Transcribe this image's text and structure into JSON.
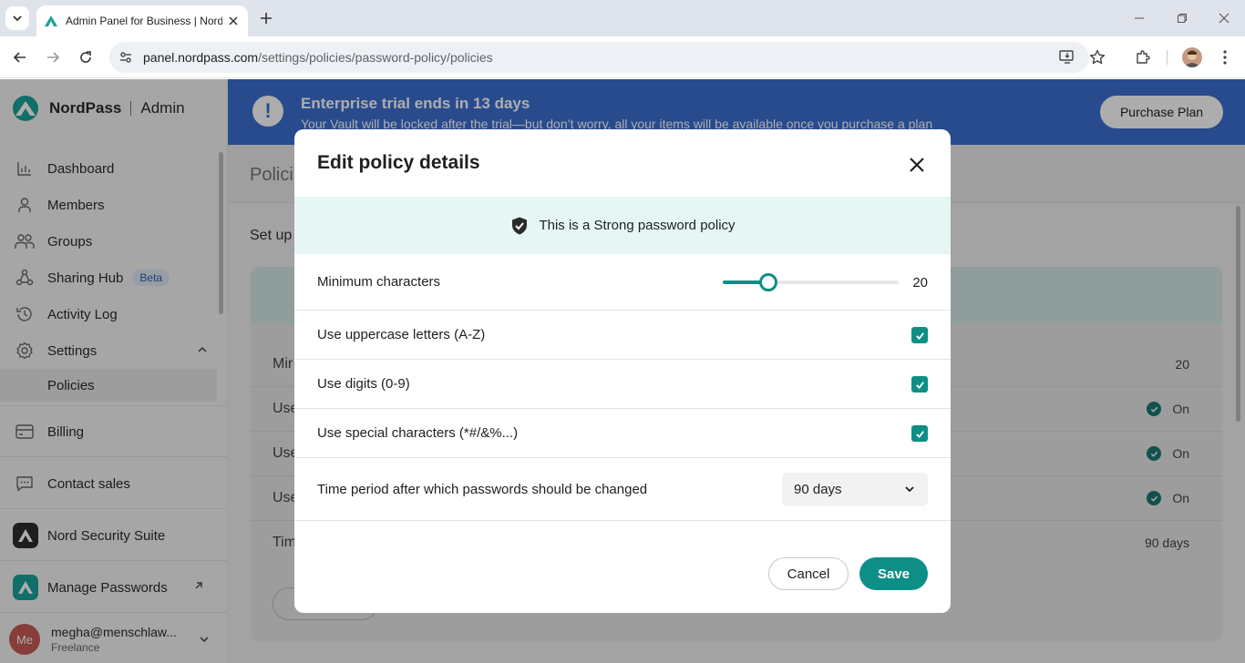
{
  "browser": {
    "tab_title": "Admin Panel for Business | NordPass",
    "url_host": "panel.nordpass.com",
    "url_path": "/settings/policies/password-policy/policies"
  },
  "sidebar": {
    "brand": "NordPass",
    "brand_suffix": "Admin",
    "items": [
      {
        "label": "Dashboard",
        "icon": "bar-chart-icon"
      },
      {
        "label": "Members",
        "icon": "person-icon"
      },
      {
        "label": "Groups",
        "icon": "group-icon"
      },
      {
        "label": "Sharing Hub",
        "icon": "share-icon",
        "badge": "Beta"
      },
      {
        "label": "Activity Log",
        "icon": "history-icon"
      },
      {
        "label": "Settings",
        "icon": "gear-icon"
      }
    ],
    "sub_item": "Policies",
    "billing": "Billing",
    "contact": "Contact sales",
    "suite": "Nord Security Suite",
    "manage": "Manage Passwords",
    "user": {
      "initials": "Me",
      "email": "megha@menschlaw...",
      "plan": "Freelance"
    }
  },
  "banner": {
    "title": "Enterprise trial ends in 13 days",
    "subtitle": "Your Vault will be locked after the trial—but don’t worry, all your items will be available once you purchase a plan",
    "button": "Purchase Plan"
  },
  "page": {
    "title": "Polici",
    "setup_text": "Set up",
    "rows": [
      {
        "label": "Mir",
        "value": "20",
        "on": false
      },
      {
        "label": "Use",
        "value": "On",
        "on": true
      },
      {
        "label": "Use",
        "value": "On",
        "on": true
      },
      {
        "label": "Use",
        "value": "On",
        "on": true
      },
      {
        "label": "Tim",
        "value": "90 days",
        "on": false
      }
    ]
  },
  "modal": {
    "title": "Edit policy details",
    "strength_text": "This is a Strong password policy",
    "min_chars_label": "Minimum characters",
    "min_chars_value": "20",
    "slider_fraction": 0.26,
    "uppercase_label": "Use uppercase letters (A-Z)",
    "digits_label": "Use digits (0-9)",
    "special_label": "Use special characters (*#/&%...)",
    "period_label": "Time period after which passwords should be changed",
    "period_value": "90 days",
    "cancel": "Cancel",
    "save": "Save"
  },
  "colors": {
    "accent": "#0d8f87",
    "banner": "#3b6fd1",
    "strong_band": "#e5f6f5"
  }
}
